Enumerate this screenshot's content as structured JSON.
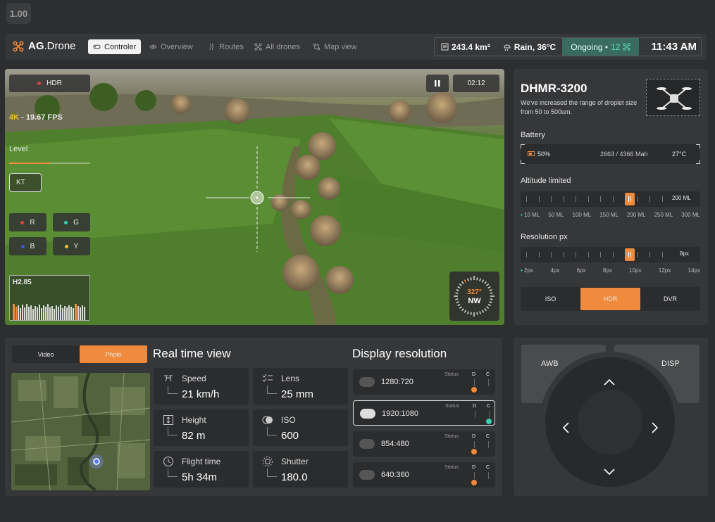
{
  "zoom_level": "1.00",
  "brand": {
    "name_bold": "AG",
    "name_rest": ".Drone"
  },
  "nav": {
    "items": [
      {
        "label": "Controler",
        "icon": "gamepad-icon"
      },
      {
        "label": "Overview",
        "icon": "eye-icon"
      },
      {
        "label": "Routes",
        "icon": "route-icon"
      },
      {
        "label": "All drones",
        "icon": "drone-icon"
      },
      {
        "label": "Map view",
        "icon": "map-icon"
      }
    ],
    "active_index": 0
  },
  "stats": {
    "area": "243.4 km²",
    "weather": "Rain, 36°C",
    "status_label": "Ongoing •",
    "status_count": "12",
    "time": "11:43 AM"
  },
  "video": {
    "hdr_label": "HDR",
    "timer": "02:12",
    "quality_accent": "4K",
    "quality_rest": " - 19.67 FPS",
    "level_label": "Level",
    "level_value": 0.5,
    "kt_label": "KT",
    "channels": [
      {
        "label": "R",
        "color": "#e0443b"
      },
      {
        "label": "G",
        "color": "#3fd0b0"
      },
      {
        "label": "B",
        "color": "#3b55e0"
      },
      {
        "label": "Y",
        "color": "#f0c030"
      }
    ],
    "histogram_label": "H2.85",
    "compass_degrees": "327°",
    "compass_dir": "NW"
  },
  "drone": {
    "model": "DHMR-3200",
    "description": "We've increased the range of  droplet size from 50 to 500um.",
    "battery_label": "Battery",
    "battery_percent": "50%",
    "battery_capacity": "2663 / 4366 Mah",
    "battery_temp": "27°C",
    "altitude_label": "Altitude limited",
    "altitude_value": "200 ML",
    "altitude_scale": [
      "10 ML",
      "50 ML",
      "100 ML",
      "150 ML",
      "200 ML",
      "250 ML",
      "300 ML"
    ],
    "resolution_label": "Resolution px",
    "resolution_value": "8px",
    "resolution_scale": [
      "2px",
      "4px",
      "6px",
      "8px",
      "10px",
      "12px",
      "14px"
    ],
    "modes": [
      "ISO",
      "HDR",
      "DVR"
    ],
    "active_mode": 1
  },
  "bottom": {
    "tabs": [
      "Video",
      "Photo"
    ],
    "active_tab": 1,
    "realtime_title": "Real time view",
    "metrics": [
      {
        "label": "Speed",
        "value": "21 km/h",
        "icon": "drone-icon"
      },
      {
        "label": "Lens",
        "value": "25 mm",
        "icon": "checklist-icon"
      },
      {
        "label": "Height",
        "value": "82 m",
        "icon": "height-icon"
      },
      {
        "label": "ISO",
        "value": "600",
        "icon": "iso-icon"
      },
      {
        "label": "Flight time",
        "value": "5h 34m",
        "icon": "clock-icon"
      },
      {
        "label": "Shutter",
        "value": "180.0",
        "icon": "shutter-icon"
      }
    ],
    "display_title": "Display resolution",
    "status_label": "Status",
    "d_label": "D",
    "c_label": "C",
    "resolutions": [
      {
        "label": "1280:720",
        "selected": false,
        "dot": "D"
      },
      {
        "label": "1920:1080",
        "selected": true,
        "dot": "C"
      },
      {
        "label": "854:480",
        "selected": false,
        "dot": "D"
      },
      {
        "label": "640:360",
        "selected": false,
        "dot": "D"
      }
    ]
  },
  "controller": {
    "awb_label": "AWB",
    "disp_label": "DISP"
  },
  "colors": {
    "accent": "#f08a3c",
    "teal": "#3fd0b0"
  }
}
